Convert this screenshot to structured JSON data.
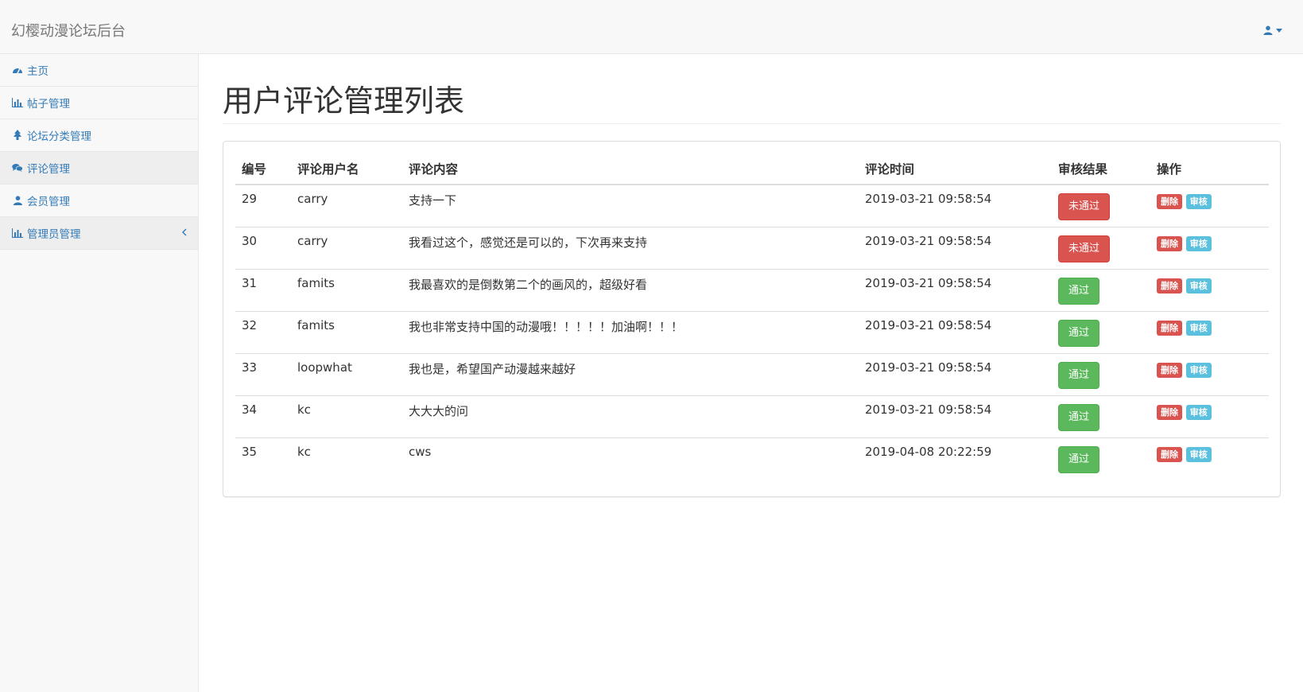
{
  "app": {
    "brand": "幻樱动漫论坛后台"
  },
  "colors": {
    "link": "#337ab7",
    "danger": "#d9534f",
    "success": "#5cb85c",
    "info": "#5bc0de"
  },
  "sidebar": {
    "items": [
      {
        "label": "主页",
        "icon": "dashboard-icon"
      },
      {
        "label": "帖子管理",
        "icon": "bar-chart-icon"
      },
      {
        "label": "论坛分类管理",
        "icon": "tree-icon"
      },
      {
        "label": "评论管理",
        "icon": "comments-icon"
      },
      {
        "label": "会员管理",
        "icon": "user-icon"
      },
      {
        "label": "管理员管理",
        "icon": "bar-chart-icon"
      }
    ]
  },
  "main": {
    "title": "用户评论管理列表",
    "table": {
      "headers": [
        "编号",
        "评论用户名",
        "评论内容",
        "评论时间",
        "审核结果",
        "操作"
      ],
      "delete_label": "删除",
      "review_label": "审核",
      "rows": [
        {
          "id": "29",
          "user": "carry",
          "content": "支持一下",
          "time": "2019-03-21 09:58:54",
          "status": "未通过",
          "approved": false
        },
        {
          "id": "30",
          "user": "carry",
          "content": "我看过这个，感觉还是可以的，下次再来支持",
          "time": "2019-03-21 09:58:54",
          "status": "未通过",
          "approved": false
        },
        {
          "id": "31",
          "user": "famits",
          "content": "我最喜欢的是倒数第二个的画风的，超级好看",
          "time": "2019-03-21 09:58:54",
          "status": "通过",
          "approved": true
        },
        {
          "id": "32",
          "user": "famits",
          "content": "我也非常支持中国的动漫哦！！！！！加油啊！！！",
          "time": "2019-03-21 09:58:54",
          "status": "通过",
          "approved": true
        },
        {
          "id": "33",
          "user": "loopwhat",
          "content": "我也是，希望国产动漫越来越好",
          "time": "2019-03-21 09:58:54",
          "status": "通过",
          "approved": true
        },
        {
          "id": "34",
          "user": "kc",
          "content": "大大大的问",
          "time": "2019-03-21 09:58:54",
          "status": "通过",
          "approved": true
        },
        {
          "id": "35",
          "user": "kc",
          "content": "cws",
          "time": "2019-04-08 20:22:59",
          "status": "通过",
          "approved": true
        }
      ]
    }
  }
}
